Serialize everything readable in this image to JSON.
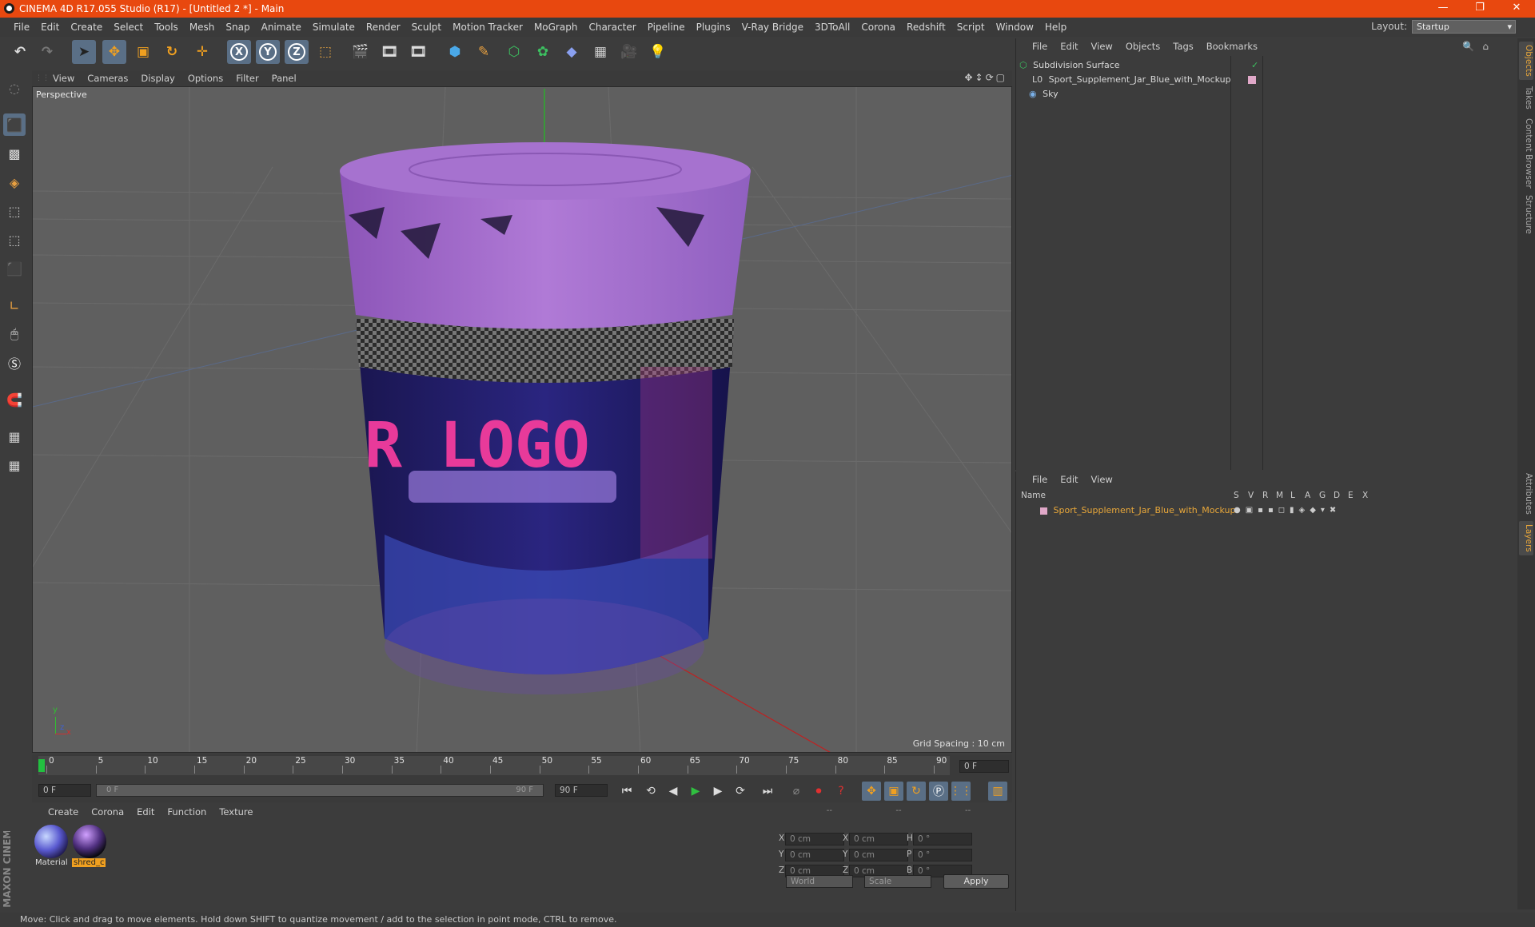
{
  "window": {
    "title": "CINEMA 4D R17.055 Studio (R17) - [Untitled 2 *] - Main"
  },
  "menubar": [
    "File",
    "Edit",
    "Create",
    "Select",
    "Tools",
    "Mesh",
    "Snap",
    "Animate",
    "Simulate",
    "Render",
    "Sculpt",
    "Motion Tracker",
    "MoGraph",
    "Character",
    "Pipeline",
    "Plugins",
    "V-Ray Bridge",
    "3DToAll",
    "Corona",
    "Redshift",
    "Script",
    "Window",
    "Help"
  ],
  "layout": {
    "label": "Layout:",
    "value": "Startup"
  },
  "toolbar": {
    "axes": [
      "X",
      "Y",
      "Z"
    ]
  },
  "viewport": {
    "menu": [
      "View",
      "Cameras",
      "Display",
      "Options",
      "Filter",
      "Panel"
    ],
    "camera_label": "Perspective",
    "grid_spacing": "Grid Spacing : 10 cm",
    "jar_label": "R LOGO",
    "axis_x": "x",
    "axis_y": "y",
    "axis_z": "z"
  },
  "timeline": {
    "ticks": [
      "0",
      "5",
      "10",
      "15",
      "20",
      "25",
      "30",
      "35",
      "40",
      "45",
      "50",
      "55",
      "60",
      "65",
      "70",
      "75",
      "80",
      "85",
      "90"
    ],
    "current_frame": "0 F",
    "start_field": "0 F",
    "range_start": "0 F",
    "range_end": "90 F",
    "end_field": "90 F"
  },
  "materials": {
    "menu": [
      "Create",
      "Corona",
      "Edit",
      "Function",
      "Texture"
    ],
    "items": [
      {
        "name": "Material",
        "selected": false
      },
      {
        "name": "shred_c",
        "selected": true
      }
    ]
  },
  "attributes": {
    "header": [
      "--",
      "--",
      "--"
    ],
    "rows": [
      {
        "a": "X",
        "av": "0 cm",
        "b": "X",
        "bv": "0 cm",
        "c": "H",
        "cv": "0 °"
      },
      {
        "a": "Y",
        "av": "0 cm",
        "b": "Y",
        "bv": "0 cm",
        "c": "P",
        "cv": "0 °"
      },
      {
        "a": "Z",
        "av": "0 cm",
        "b": "Z",
        "bv": "0 cm",
        "c": "B",
        "cv": "0 °"
      }
    ],
    "coord_mode": "World",
    "size_mode": "Scale",
    "apply_label": "Apply"
  },
  "object_manager": {
    "menu": [
      "File",
      "Edit",
      "View",
      "Objects",
      "Tags",
      "Bookmarks"
    ],
    "objects": [
      "Subdivision Surface",
      "Sport_Supplement_Jar_Blue_with_Mockup",
      "Sky"
    ]
  },
  "layer_manager": {
    "menu": [
      "File",
      "Edit",
      "View"
    ],
    "columns": [
      "Name",
      "S",
      "V",
      "R",
      "M",
      "L",
      "A",
      "G",
      "D",
      "E",
      "X"
    ],
    "layers": [
      "Sport_Supplement_Jar_Blue_with_Mockup"
    ]
  },
  "right_tabs": [
    "Objects",
    "Takes",
    "Content Browser",
    "Structure",
    "Attributes",
    "Layers"
  ],
  "brand": "MAXON CINEMA 4D",
  "status": "Move: Click and drag to move elements. Hold down SHIFT to quantize movement / add to the selection in point mode, CTRL to remove.",
  "colors": {
    "titlebar": "#e8480f",
    "accent": "#e8a73a",
    "selection": "#5a6f86"
  }
}
